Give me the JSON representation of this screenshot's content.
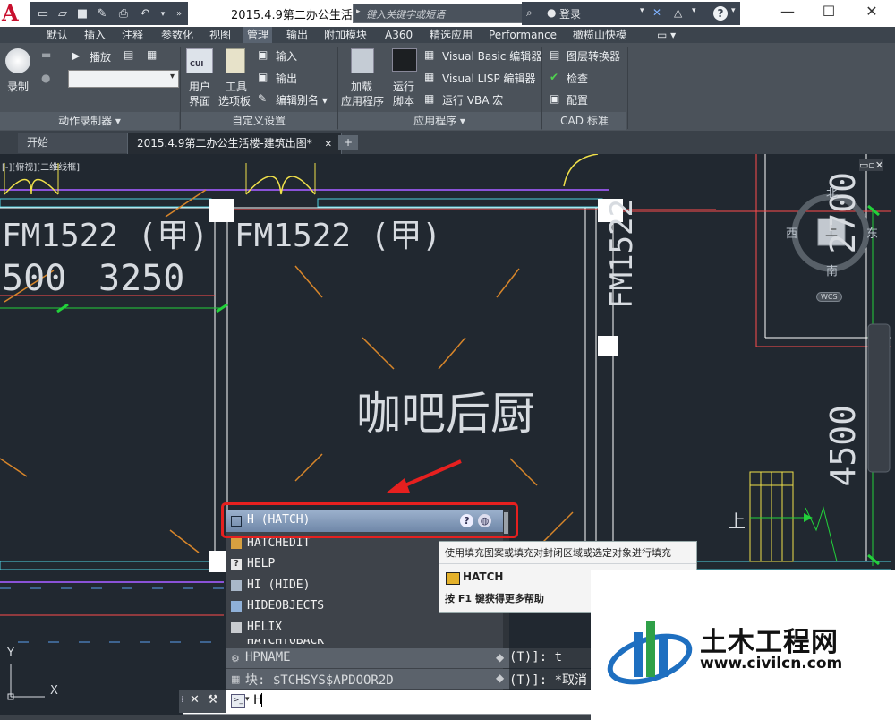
{
  "window": {
    "document_title": "2015.4.9第二办公生活...",
    "search_placeholder": "键入关键字或短语",
    "login": "登录",
    "help": "?"
  },
  "tabs": [
    {
      "label": "默认"
    },
    {
      "label": "插入"
    },
    {
      "label": "注释"
    },
    {
      "label": "参数化"
    },
    {
      "label": "视图"
    },
    {
      "label": "管理"
    },
    {
      "label": "输出"
    },
    {
      "label": "附加模块"
    },
    {
      "label": "A360"
    },
    {
      "label": "精选应用"
    },
    {
      "label": "Performance"
    },
    {
      "label": "橄榄山快模"
    }
  ],
  "ribbon": {
    "record": "录制",
    "play": "播放",
    "panel_action": "动作录制器 ▾",
    "user_interface_1": "用户",
    "user_interface_2": "界面",
    "tool_palette_1": "工具",
    "tool_palette_2": "选项板",
    "import": "输入",
    "export": "输出",
    "edit_alias": "编辑别名 ▾",
    "panel_custom": "自定义设置",
    "load_app_1": "加载",
    "load_app_2": "应用程序",
    "run_script_1": "运行",
    "run_script_2": "脚本",
    "vb_editor": "Visual Basic 编辑器",
    "lisp_editor": "Visual LISP 编辑器",
    "run_vba": "运行 VBA 宏",
    "panel_app": "应用程序 ▾",
    "layer_translator": "图层转换器",
    "check": "检查",
    "configure": "配置",
    "panel_cad": "CAD 标准"
  },
  "doc_tabs": {
    "start": "开始",
    "drawing": "2015.4.9第二办公生活楼-建筑出图*",
    "add": "+"
  },
  "viewport_label": "[-][俯视][二维线框]",
  "drawing": {
    "door_label_1": "FM1522 (甲)",
    "door_label_2": "FM1522 (甲)",
    "door_label_vertical": "FM1522",
    "dim_1": "500",
    "dim_2": "3250",
    "dim_vertical_1": "2700",
    "dim_vertical_2": "4500",
    "room_name": "咖吧后厨",
    "stair_up": "上"
  },
  "viewcube": {
    "north": "北",
    "south": "南",
    "east": "东",
    "west": "西",
    "top": "上",
    "wcs": "WCS"
  },
  "autocomplete": {
    "items": [
      {
        "label": "H (HATCH)"
      },
      {
        "label": "HATCHEDIT"
      },
      {
        "label": "HELP"
      },
      {
        "label": "HI (HIDE)"
      },
      {
        "label": "HIDEOBJECTS"
      },
      {
        "label": "HELIX"
      },
      {
        "label": "HATCHTOBACK"
      }
    ]
  },
  "tooltip": {
    "description": "使用填充图案或填充对封闭区域或选定对象进行填充",
    "command": "HATCH",
    "help": "按 F1 键获得更多帮助"
  },
  "history": {
    "row1_left": "HPNAME",
    "row1_right": "(T)]: t",
    "row2_left": "块: $TCHSYS$APDOOR2D",
    "row2_right": "(T)]: *取消"
  },
  "command_line": {
    "value": "H"
  },
  "ucs": {
    "x": "X",
    "y": "Y"
  },
  "watermark": {
    "title": "土木工程网",
    "url": "www.civilcn.com"
  },
  "colors": {
    "canvas": "#212830",
    "red_highlight": "#e6201f",
    "wall_cyan": "#4fd1e0",
    "dim_green": "#22d13a",
    "hatch_orange": "#d8862a"
  }
}
